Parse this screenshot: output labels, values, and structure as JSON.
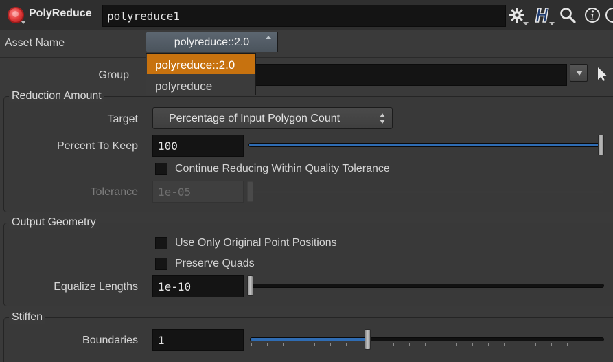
{
  "header": {
    "node_type": "PolyReduce",
    "node_name": "polyreduce1",
    "icons": [
      "node-type-icon",
      "gear-icon",
      "help-h-icon",
      "search-icon",
      "info-icon",
      "more-icon"
    ]
  },
  "asset": {
    "label": "Asset Name",
    "selected": "polyreduce::2.0",
    "options": [
      "polyreduce::2.0",
      "polyreduce"
    ]
  },
  "group": {
    "label": "Group",
    "value": ""
  },
  "reduction": {
    "title": "Reduction Amount",
    "target_label": "Target",
    "target_value": "Percentage of Input Polygon Count",
    "percent_label": "Percent To Keep",
    "percent_value": "100",
    "percent_fraction": 1.0,
    "continue_label": "Continue Reducing Within Quality Tolerance",
    "continue_checked": false,
    "tolerance_label": "Tolerance",
    "tolerance_value": "1e-05"
  },
  "output": {
    "title": "Output Geometry",
    "original_points_label": "Use Only Original Point Positions",
    "original_points_checked": false,
    "preserve_quads_label": "Preserve Quads",
    "preserve_quads_checked": false,
    "equalize_label": "Equalize Lengths",
    "equalize_value": "1e-10"
  },
  "stiffen": {
    "title": "Stiffen",
    "boundaries_label": "Boundaries",
    "boundaries_value": "1",
    "boundaries_fraction": 0.33
  },
  "colors": {
    "accent_selected": "#c7720f",
    "slider_fill": "#2f6cb3",
    "background": "#3a3a3a"
  }
}
